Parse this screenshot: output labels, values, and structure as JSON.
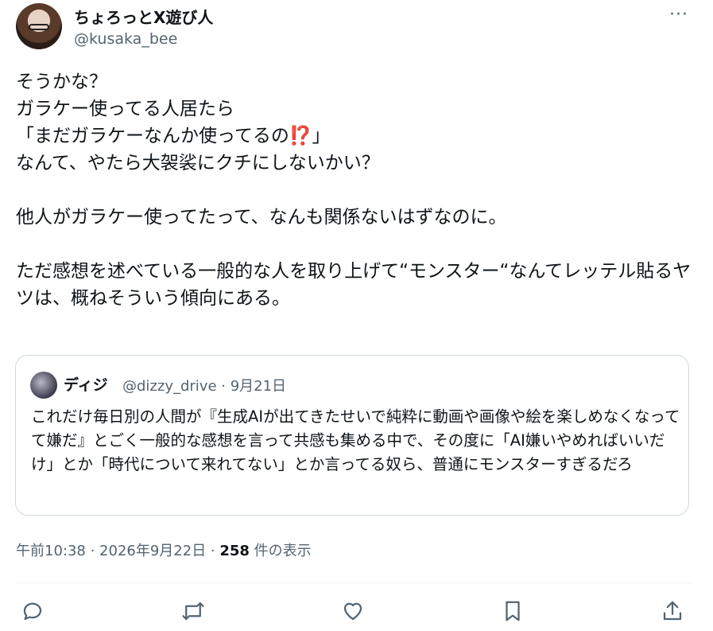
{
  "author": {
    "display_name": "ちょろっとX遊び人",
    "handle": "@kusaka_bee"
  },
  "more_icon": "···",
  "post_text": "そうかな？\nガラケー使ってる人居たら\n「まだガラケーなんか使ってるの⁉️」\nなんて、やたら大袈裟にクチにしないかい？\n\n他人がガラケー使ってたって、なんも関係ないはずなのに。\n\nただ感想を述べている一般的な人を取り上げて“モンスター“なんてレッテル貼るヤツは、概ねそういう傾向にある。",
  "quote": {
    "name": "ディジ",
    "meta": "@dizzy_drive · 9月21日",
    "text": "これだけ毎日別の人間が『生成AIが出てきたせいで純粋に動画や画像や絵を楽しめなくなってて嫌だ』とごく一般的な感想を言って共感も集める中で、その度に「AI嫌いやめればいいだけ」とか「時代について来れてない」とか言ってる奴ら、普通にモンスターすぎるだろ"
  },
  "meta": {
    "time": "午前10:38 · 2026年9月22日 · ",
    "views": "258",
    "views_label": " 件の表示"
  },
  "actions": [
    "reply-icon",
    "retweet-icon",
    "like-icon",
    "bookmark-icon",
    "share-icon"
  ],
  "colors": {
    "icon": "#536471",
    "border": "#cfd9de"
  }
}
